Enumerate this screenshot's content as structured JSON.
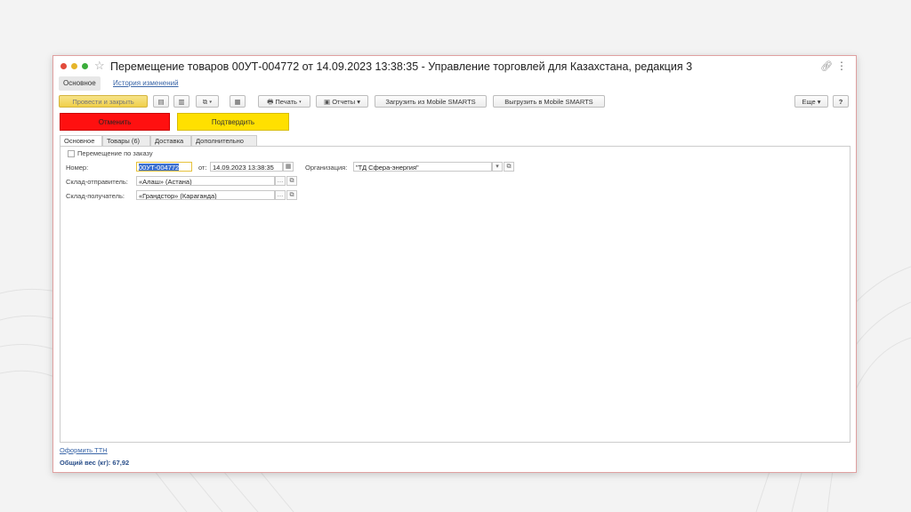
{
  "window": {
    "title": "Перемещение товаров 00УТ-004772 от 14.09.2023 13:38:35 - Управление торговлей для Казахстана, редакция 3"
  },
  "nav": {
    "main_tab": "Основное",
    "history_link": "История изменений"
  },
  "toolbar": {
    "post_close": "Провести и закрыть",
    "print": "Печать",
    "reports": "Отчеты",
    "load_mobile": "Загрузить из Mobile SMARTS",
    "unload_mobile": "Выгрузить в Mobile SMARTS",
    "more": "Еще",
    "help": "?"
  },
  "actions": {
    "cancel": "Отменить",
    "confirm": "Подтвердить"
  },
  "tabs": [
    {
      "label": "Основное"
    },
    {
      "label": "Товары (6)"
    },
    {
      "label": "Доставка"
    },
    {
      "label": "Дополнительно"
    }
  ],
  "form": {
    "by_order_label": "Перемещение по заказу",
    "number_label": "Номер:",
    "number_value": "00УТ-004772",
    "date_label": "от:",
    "date_value": "14.09.2023 13:38:35",
    "org_label": "Организация:",
    "org_value": "\"ТД Сфера-энергия\"",
    "sender_label": "Склад-отправитель:",
    "sender_value": "«Алаш»  (Астана)",
    "receiver_label": "Склад-получатель:",
    "receiver_value": "«Грандстор» (Караганда)"
  },
  "footer": {
    "ttn_link": "Оформить ТТН",
    "total_weight": "Общий вес (кг):  67,92"
  }
}
